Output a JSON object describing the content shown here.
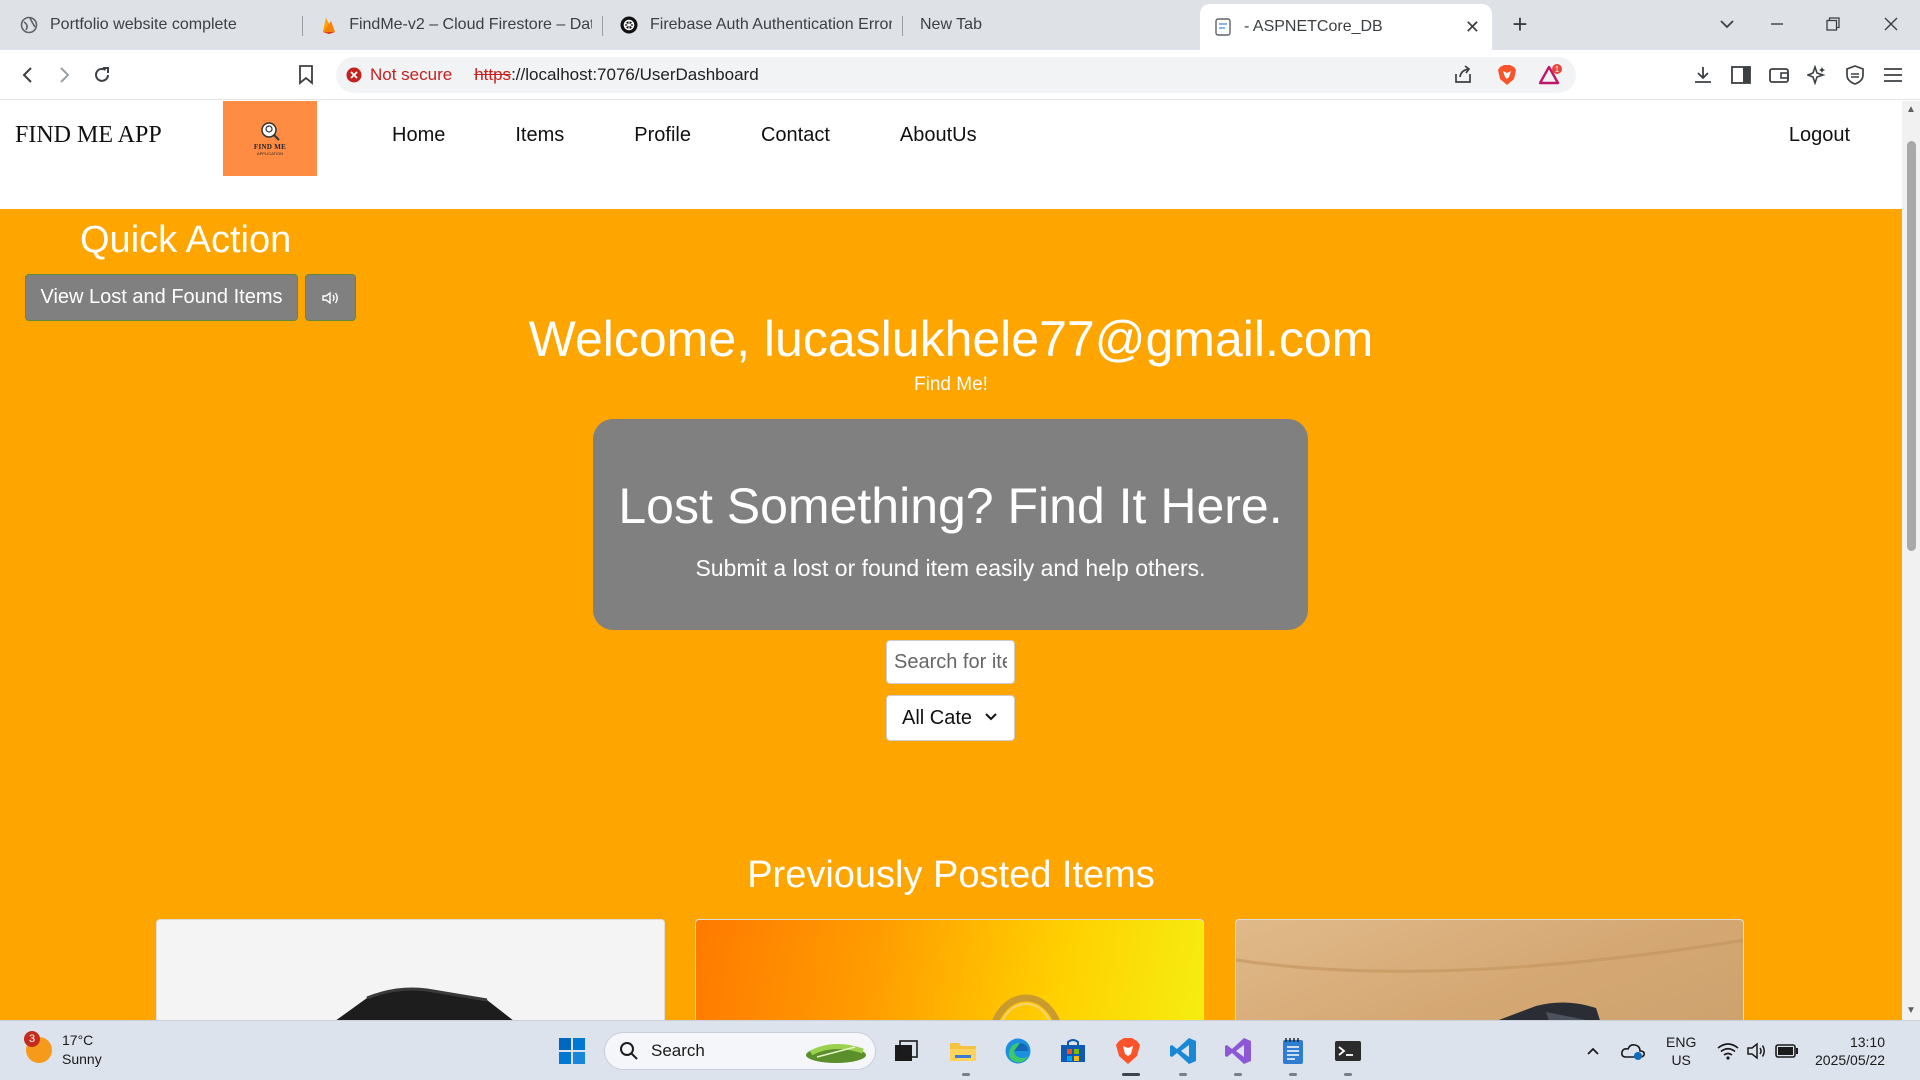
{
  "browser": {
    "tabs": [
      {
        "label": "Portfolio website complete",
        "icon": "globe-icon"
      },
      {
        "label": "FindMe-v2 – Cloud Firestore – Data",
        "icon": "firebase-icon"
      },
      {
        "label": "Firebase Auth Authentication Error",
        "icon": "openai-icon"
      },
      {
        "label": "New Tab",
        "icon": ""
      },
      {
        "label": "- ASPNETCore_DB",
        "icon": "page-icon",
        "active": true
      }
    ],
    "security_label": "Not secure",
    "url_scheme": "https",
    "url_rest": "://localhost:7076/UserDashboard",
    "brave_rewards_count": "1"
  },
  "header": {
    "brand": "FIND ME APP",
    "logo_title": "FIND ME",
    "logo_subtitle": "APPLICATION",
    "nav": [
      "Home",
      "Items",
      "Profile",
      "Contact",
      "AboutUs"
    ],
    "logout": "Logout",
    "logo_color": "#ff8c42"
  },
  "hero": {
    "quick_action_title": "Quick Action",
    "view_items_button": "View Lost and Found Items",
    "welcome": "Welcome, lucaslukhele77@gmail.com",
    "tagline": "Find Me!",
    "banner_title": "Lost Something? Find It Here.",
    "banner_subtitle": "Submit a lost or found item easily and help others.",
    "search_placeholder": "Search for items...",
    "category_selected": "All Cate",
    "previous_title": "Previously Posted Items",
    "background_color": "#ffa500",
    "banner_color": "#808080"
  },
  "taskbar": {
    "weather_temp": "17°C",
    "weather_desc": "Sunny",
    "weather_badge": "3",
    "search_label": "Search",
    "lang_top": "ENG",
    "lang_bottom": "US",
    "time": "13:10",
    "date": "2025/05/22"
  }
}
